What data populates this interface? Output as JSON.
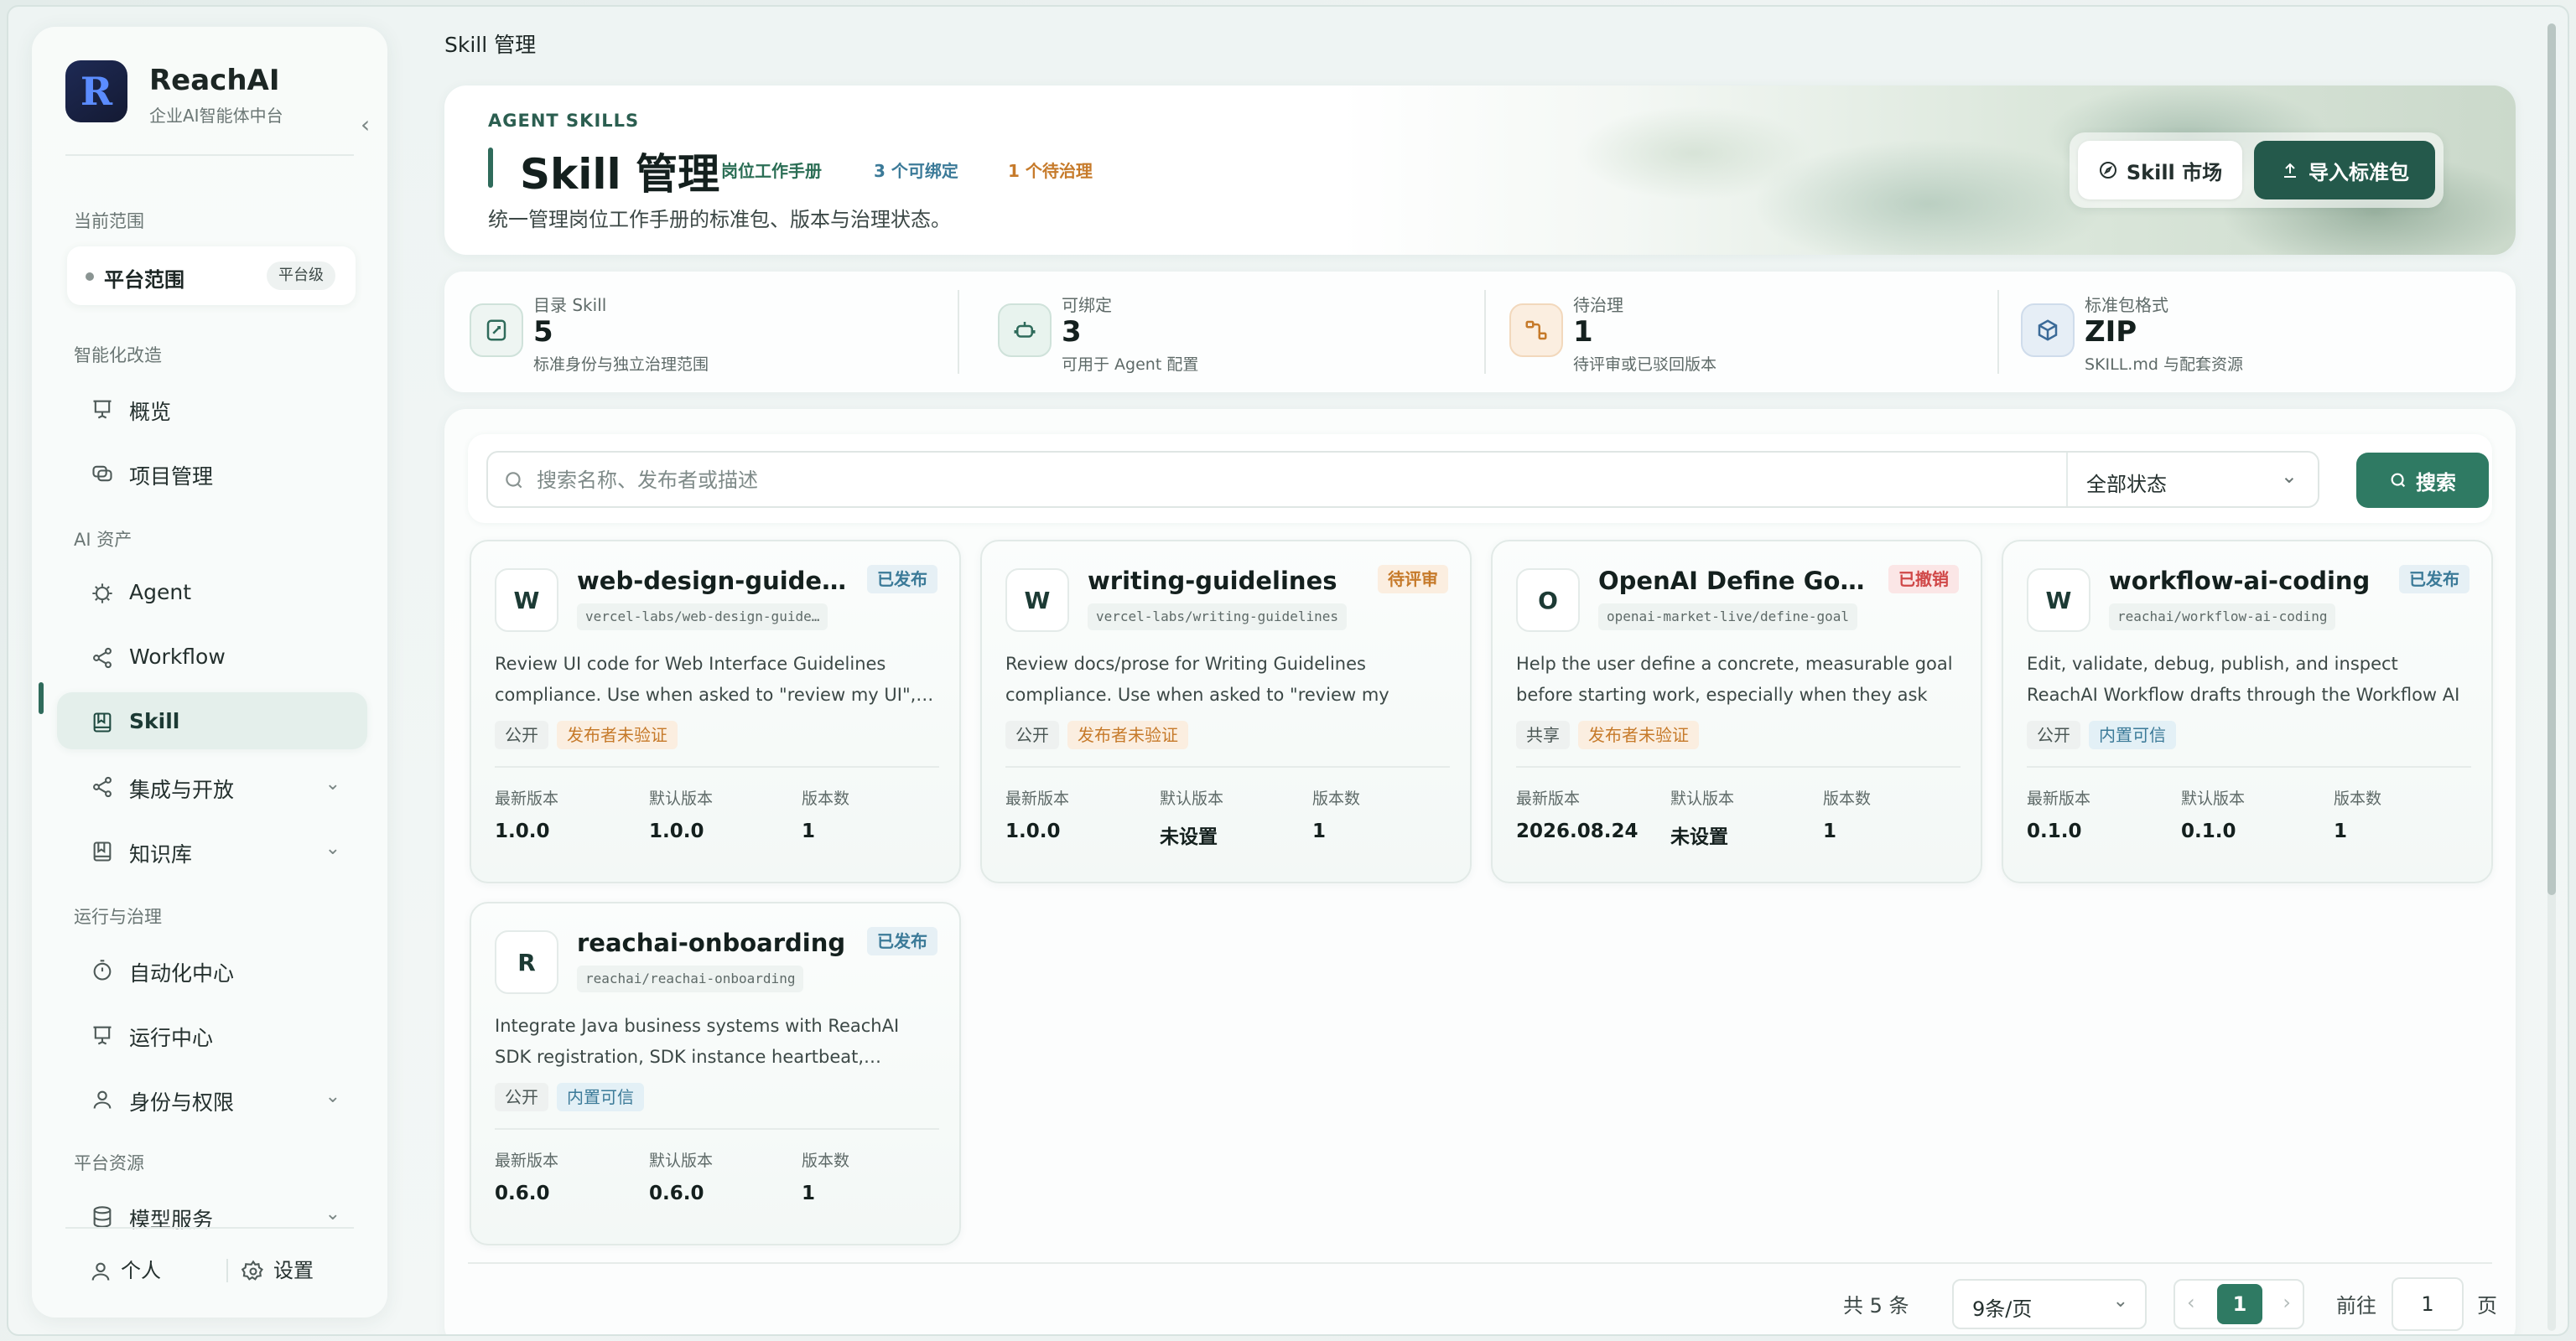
{
  "colors": {
    "accent": "#2f7a63",
    "accent_dark": "#24594b",
    "status_published": "#3b7a98",
    "status_review": "#c67a2a",
    "status_revoked": "#d04848"
  },
  "sidebar": {
    "brand_name": "ReachAI",
    "brand_sub": "企业AI智能体中台",
    "logo_letter": "R",
    "scope_label": "当前范围",
    "scope_value": "平台范围",
    "scope_badge": "平台级",
    "sections": {
      "intelligent": "智能化改造",
      "ai_assets": "AI 资产",
      "ops": "运行与治理",
      "platform": "平台资源"
    },
    "items": [
      {
        "label": "概览",
        "icon": "presentation-icon"
      },
      {
        "label": "项目管理",
        "icon": "projects-icon"
      },
      {
        "label": "Agent",
        "icon": "agent-icon"
      },
      {
        "label": "Workflow",
        "icon": "share-icon"
      },
      {
        "label": "Skill",
        "icon": "book-icon"
      },
      {
        "label": "集成与开放",
        "icon": "share-icon"
      },
      {
        "label": "知识库",
        "icon": "book-icon"
      },
      {
        "label": "自动化中心",
        "icon": "timer-icon"
      },
      {
        "label": "运行中心",
        "icon": "presentation-icon"
      },
      {
        "label": "身份与权限",
        "icon": "user-icon"
      },
      {
        "label": "模型服务",
        "icon": "database-icon"
      }
    ],
    "footer": {
      "personal": "个人",
      "settings": "设置"
    }
  },
  "breadcrumb": "Skill 管理",
  "hero": {
    "kicker": "AGENT SKILLS",
    "title": "Skill 管理",
    "chip_manual": "岗位工作手册",
    "chip_bindable": "3 个可绑定",
    "chip_pending": "1 个待治理",
    "desc": "统一管理岗位工作手册的标准包、版本与治理状态。",
    "btn_market": "Skill 市场",
    "btn_import": "导入标准包"
  },
  "stats": [
    {
      "label": "目录 Skill",
      "value": "5",
      "sub": "标准身份与独立治理范围",
      "icon": "catalog-icon"
    },
    {
      "label": "可绑定",
      "value": "3",
      "sub": "可用于 Agent 配置",
      "icon": "robot-icon"
    },
    {
      "label": "待治理",
      "value": "1",
      "sub": "待评审或已驳回版本",
      "icon": "flow-icon"
    },
    {
      "label": "标准包格式",
      "value": "ZIP",
      "sub": "SKILL.md 与配套资源",
      "icon": "package-icon"
    }
  ],
  "search": {
    "placeholder": "搜索名称、发布者或描述",
    "value": "",
    "status_value": "全部状态",
    "button": "搜索"
  },
  "meta_labels": {
    "latest": "最新版本",
    "default": "默认版本",
    "count": "版本数"
  },
  "cards": [
    {
      "initial": "W",
      "name": "web-design-guidelines",
      "slug": "vercel-labs/web-design-guide…",
      "status": "已发布",
      "desc": "Review UI code for Web Interface Guidelines compliance. Use when asked to \"review my UI\",…",
      "tags": [
        "公开",
        "发布者未验证"
      ],
      "latest": "1.0.0",
      "default": "1.0.0",
      "count": "1"
    },
    {
      "initial": "W",
      "name": "writing-guidelines",
      "slug": "vercel-labs/writing-guidelines",
      "status": "待评审",
      "desc": "Review docs/prose for Writing Guidelines compliance. Use when asked to \"review my docs\"…",
      "tags": [
        "公开",
        "发布者未验证"
      ],
      "latest": "1.0.0",
      "default": "未设置",
      "count": "1"
    },
    {
      "initial": "O",
      "name": "OpenAI Define Goal L…",
      "slug": "openai-market-live/define-goal",
      "status": "已撤销",
      "desc": "Help the user define a concrete, measurable goal before starting work, especially when they ask to…",
      "tags": [
        "共享",
        "发布者未验证"
      ],
      "latest": "2026.08.24",
      "default": "未设置",
      "count": "1"
    },
    {
      "initial": "W",
      "name": "workflow-ai-coding",
      "slug": "reachai/workflow-ai-coding",
      "status": "已发布",
      "desc": "Edit, validate, debug, publish, and inspect ReachAI Workflow drafts through the Workflow AI Coding…",
      "tags": [
        "公开",
        "内置可信"
      ],
      "latest": "0.1.0",
      "default": "0.1.0",
      "count": "1"
    },
    {
      "initial": "R",
      "name": "reachai-onboarding",
      "slug": "reachai/reachai-onboarding",
      "status": "已发布",
      "desc": "Integrate Java business systems with ReachAI SDK registration, SDK instance heartbeat,…",
      "tags": [
        "公开",
        "内置可信"
      ],
      "latest": "0.6.0",
      "default": "0.6.0",
      "count": "1"
    }
  ],
  "pagination": {
    "total": "共 5 条",
    "page_size": "9条/页",
    "current": "1",
    "goto_label": "前往",
    "goto_value": "1",
    "unit": "页"
  }
}
